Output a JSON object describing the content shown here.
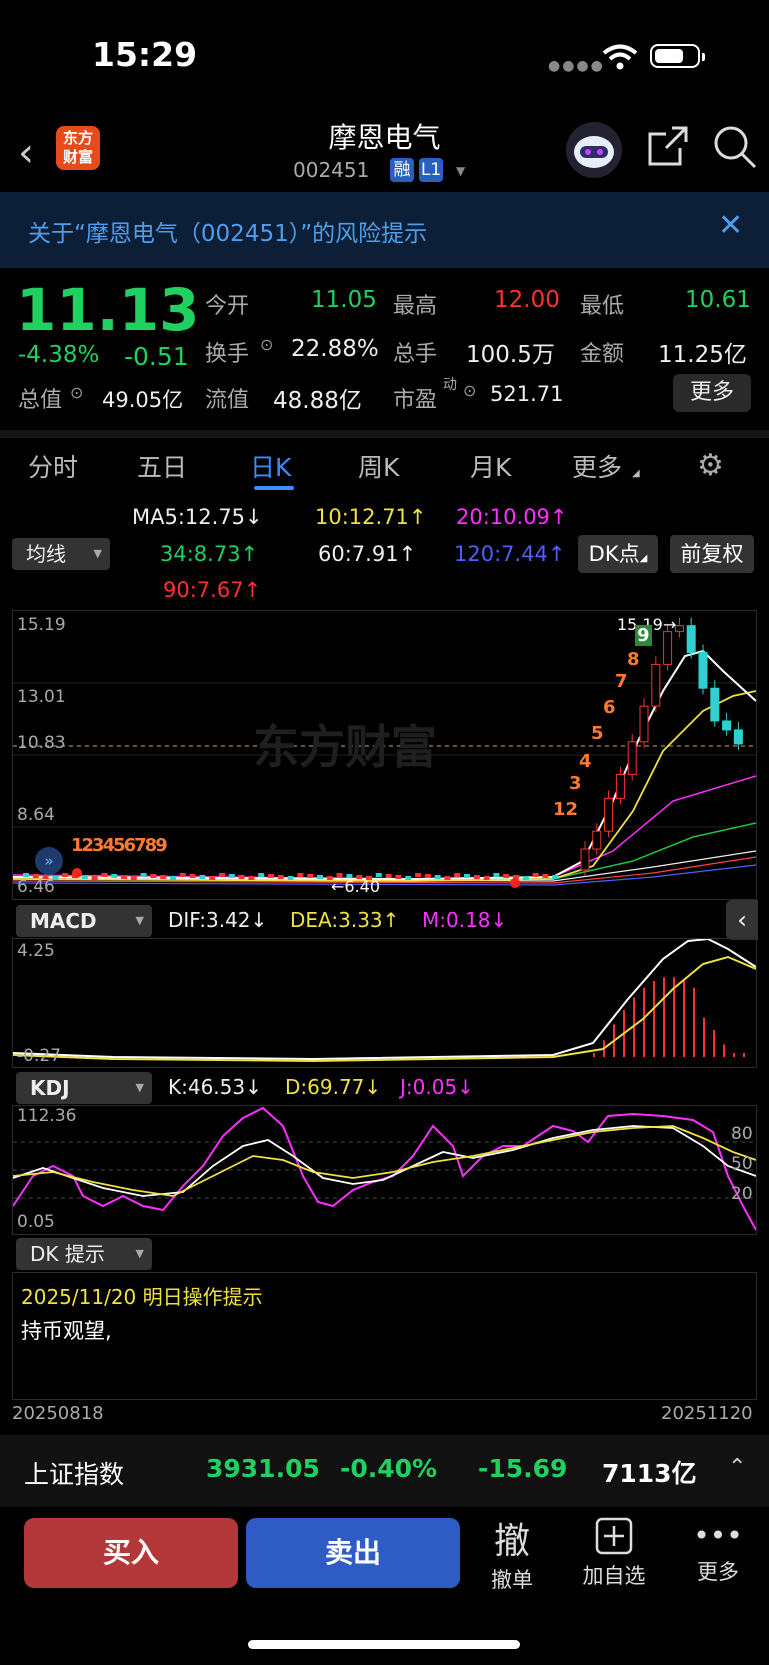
{
  "status_bar": {
    "time": "15:29"
  },
  "header": {
    "logo_line1": "东方",
    "logo_line2": "财富",
    "title": "摩恩电气",
    "code": "002451",
    "tag1": "融",
    "tag2": "L1"
  },
  "risk_banner": {
    "text": "关于“摩恩电气（002451）”的风险提示"
  },
  "quote": {
    "price": "11.13",
    "change_pct": "-4.38%",
    "change": "-0.51",
    "open_label": "今开",
    "open": "11.05",
    "high_label": "最高",
    "high": "12.00",
    "low_label": "最低",
    "low": "10.61",
    "turnover_label": "换手",
    "turnover": "22.88%",
    "volume_label": "总手",
    "volume": "100.5万",
    "amount_label": "金额",
    "amount": "11.25亿",
    "mktcap_label": "总值",
    "mktcap": "49.05亿",
    "float_label": "流值",
    "float": "48.88亿",
    "pe_label": "市盈",
    "pe_sup": "动",
    "pe": "521.71",
    "more": "更多"
  },
  "tabs": [
    "分时",
    "五日",
    "日K",
    "周K",
    "月K",
    "更多"
  ],
  "ma": {
    "selector": "均线",
    "ma5": "MA5:12.75",
    "ma10": "10:12.71",
    "ma20": "20:10.09",
    "ma34": "34:8.73",
    "ma60": "60:7.91",
    "ma120": "120:7.44",
    "ma90": "90:7.67",
    "dk_button": "DK点",
    "adj_button": "前复权"
  },
  "kline": {
    "y_labels": [
      "15.19",
      "13.01",
      "10.83",
      "8.64",
      "6.46"
    ],
    "peak_label": "15.19",
    "low_label": "6.40",
    "watermark": "东方财富",
    "early_seq": "123456789",
    "late_nums": [
      "12",
      "3",
      "4",
      "5",
      "6",
      "7",
      "8",
      "9"
    ]
  },
  "macd": {
    "selector": "MACD",
    "dif": "DIF:3.42",
    "dea": "DEA:3.33",
    "m": "M:0.18",
    "y_top": "4.25",
    "y_bot": "-0.27"
  },
  "kdj": {
    "selector": "KDJ",
    "k": "K:46.53",
    "d": "D:69.77",
    "j": "J:0.05",
    "y_top": "112.36",
    "y_bot": "0.05",
    "levels": [
      "80",
      "50",
      "20"
    ]
  },
  "dk": {
    "selector": "DK 提示",
    "date_line": "2025/11/20 明日操作提示",
    "advice": "持币观望,"
  },
  "dates": {
    "start": "20250818",
    "end": "20251120"
  },
  "index_bar": {
    "name": "上证指数",
    "value": "3931.05",
    "pct": "-0.40%",
    "change": "-15.69",
    "amount": "7113亿"
  },
  "bottom": {
    "buy": "买入",
    "sell": "卖出",
    "cancel_glyph": "撤",
    "cancel": "撤单",
    "watch": "加自选",
    "more": "更多"
  },
  "chart_data": {
    "type": "candlestick",
    "y_range": [
      6.46,
      15.19
    ],
    "recent_closes": [
      7.6,
      8.2,
      9.3,
      10.1,
      11.2,
      12.4,
      13.8,
      14.9,
      15.1,
      14.2,
      13.0,
      11.9,
      11.6,
      11.13
    ]
  }
}
